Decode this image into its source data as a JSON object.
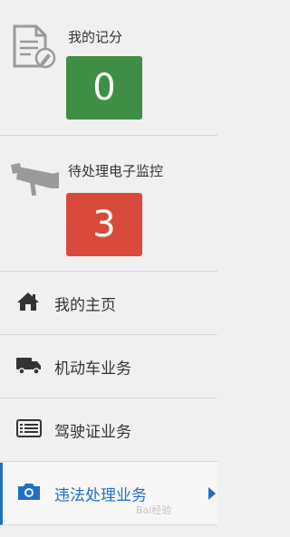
{
  "stats": [
    {
      "title": "我的记分",
      "value": "0",
      "color": "#3e8e46",
      "icon": "document-pen-icon"
    },
    {
      "title": "待处理电子监控",
      "value": "3",
      "color": "#d94a3c",
      "icon": "surveillance-camera-icon"
    }
  ],
  "nav": [
    {
      "label": "我的主页",
      "icon": "home-icon",
      "active": false
    },
    {
      "label": "机动车业务",
      "icon": "truck-icon",
      "active": false
    },
    {
      "label": "驾驶证业务",
      "icon": "license-card-icon",
      "active": false
    },
    {
      "label": "违法处理业务",
      "icon": "camera-icon",
      "active": true
    }
  ],
  "colors": {
    "accent": "#1f6fc5",
    "text": "#333333",
    "background": "#f0f0f0"
  },
  "watermark": "Bai经验"
}
